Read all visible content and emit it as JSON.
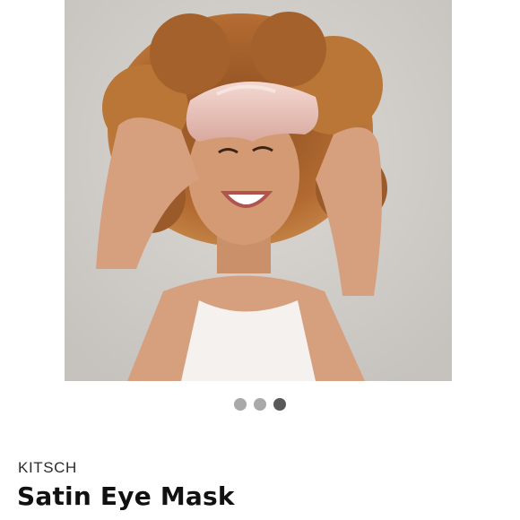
{
  "product": {
    "brand": "KITSCH",
    "name": "Satin Eye Mask"
  },
  "carousel": {
    "slide_count": 3,
    "active_index": 2
  },
  "colors": {
    "dot_inactive": "#a9a9a9",
    "dot_active": "#595959",
    "background": "#ffffff"
  }
}
